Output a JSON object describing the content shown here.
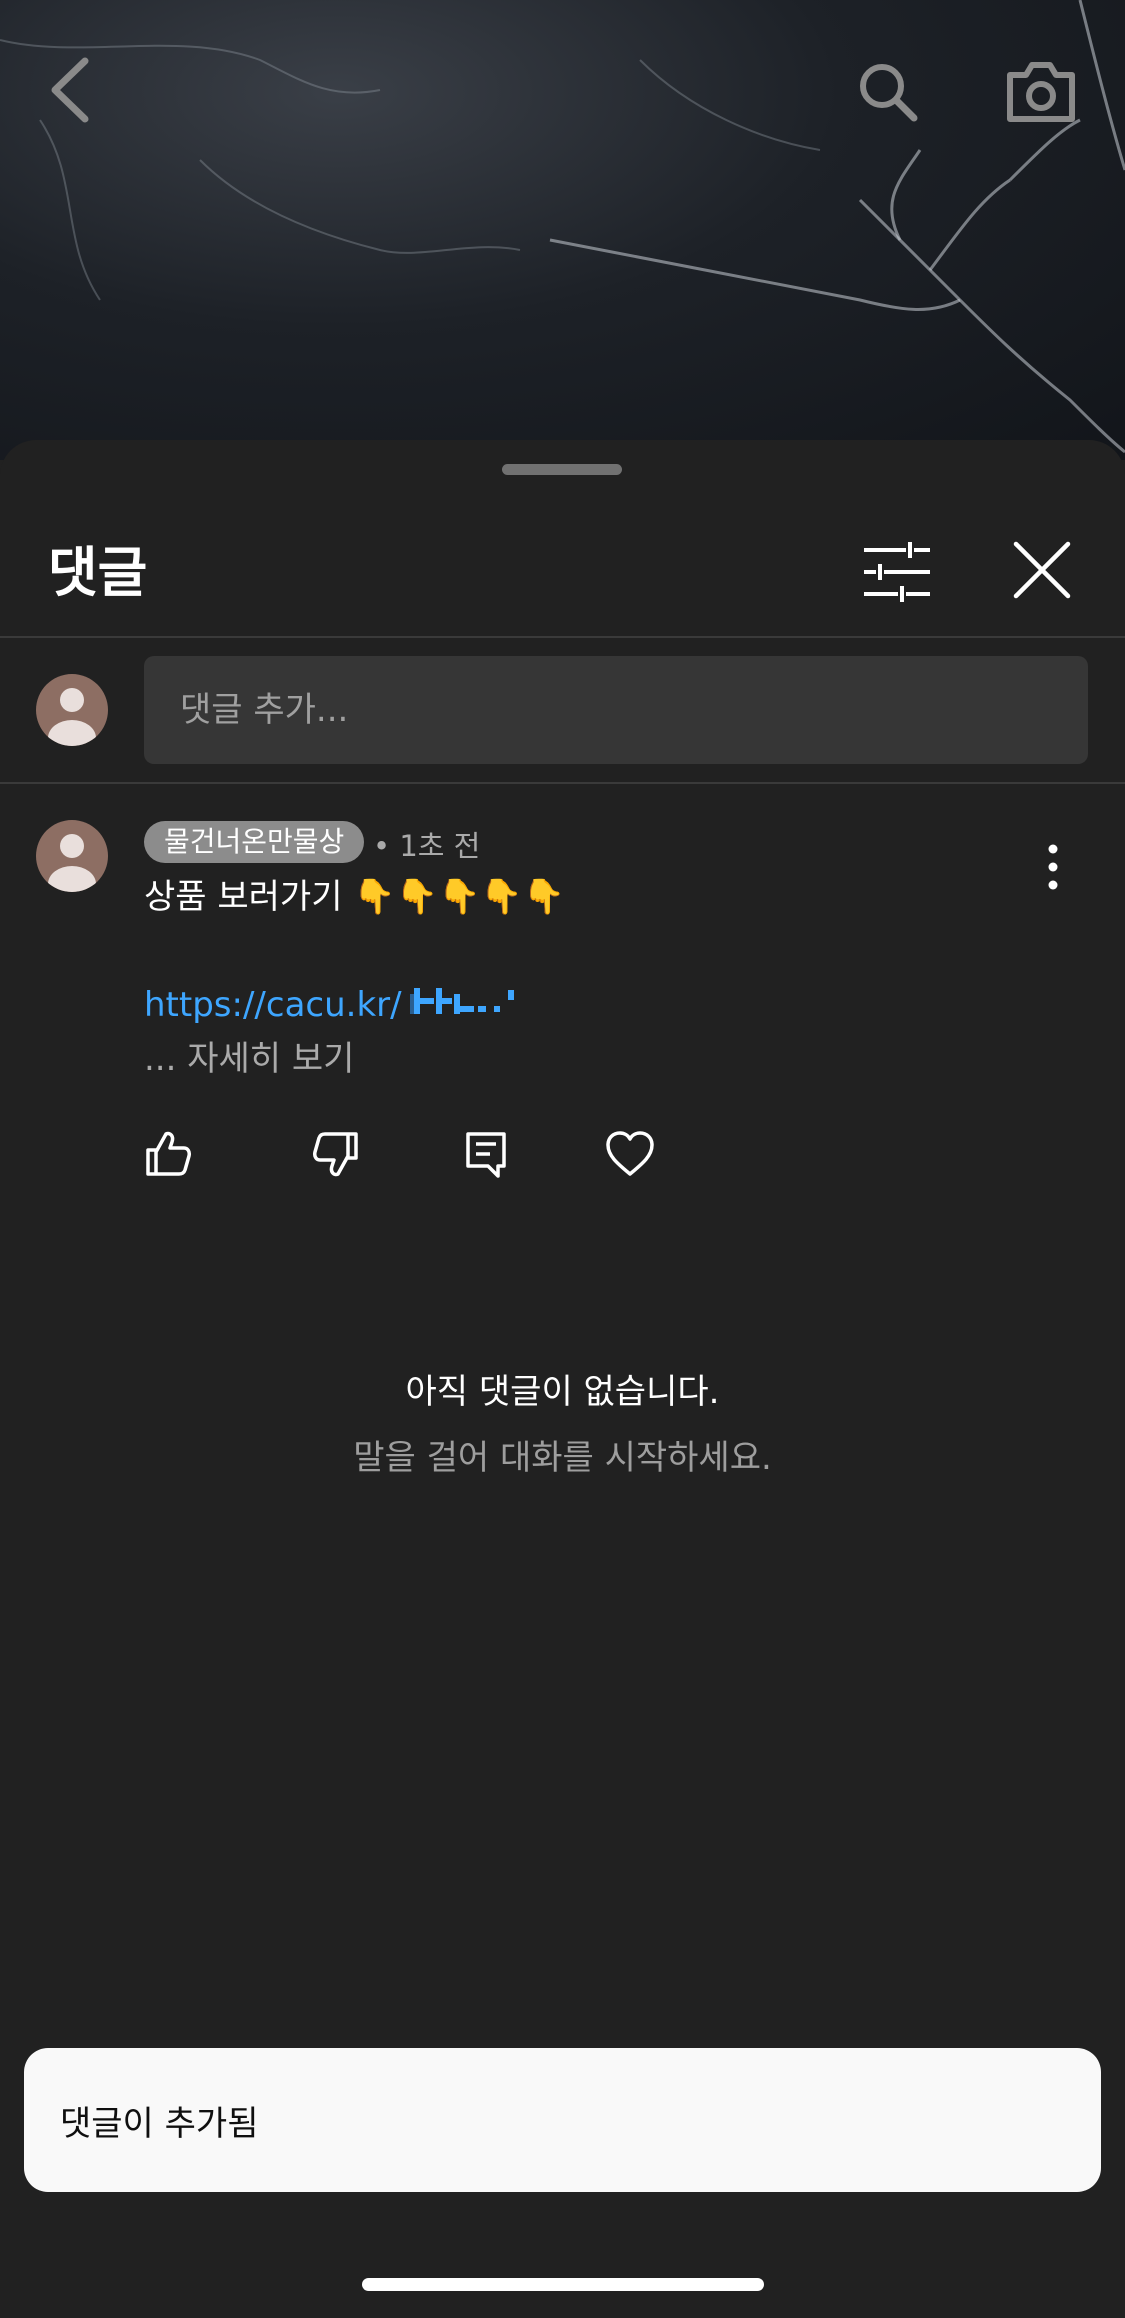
{
  "sheet": {
    "title": "댓글",
    "input_placeholder": "댓글 추가..."
  },
  "comment": {
    "author": "물건너온만물상",
    "timestamp": "• 1초 전",
    "body": "상품 보러가기 👇👇👇👇👇",
    "link": "https://cacu.kr/",
    "see_more": "... 자세히 보기",
    "link_color": "#3ea6ff"
  },
  "empty_state": {
    "title": "아직 댓글이 없습니다.",
    "subtitle": "말을 걸어 대화를 시작하세요."
  },
  "toast": {
    "message": "댓글이 추가됨"
  },
  "icons": {
    "back": "chevron-left-icon",
    "search": "search-icon",
    "camera": "camera-icon",
    "filter": "sliders-icon",
    "close": "close-icon",
    "more": "more-vertical-icon",
    "like": "thumbs-up-icon",
    "dislike": "thumbs-down-icon",
    "reply": "comment-icon",
    "heart": "heart-icon"
  }
}
